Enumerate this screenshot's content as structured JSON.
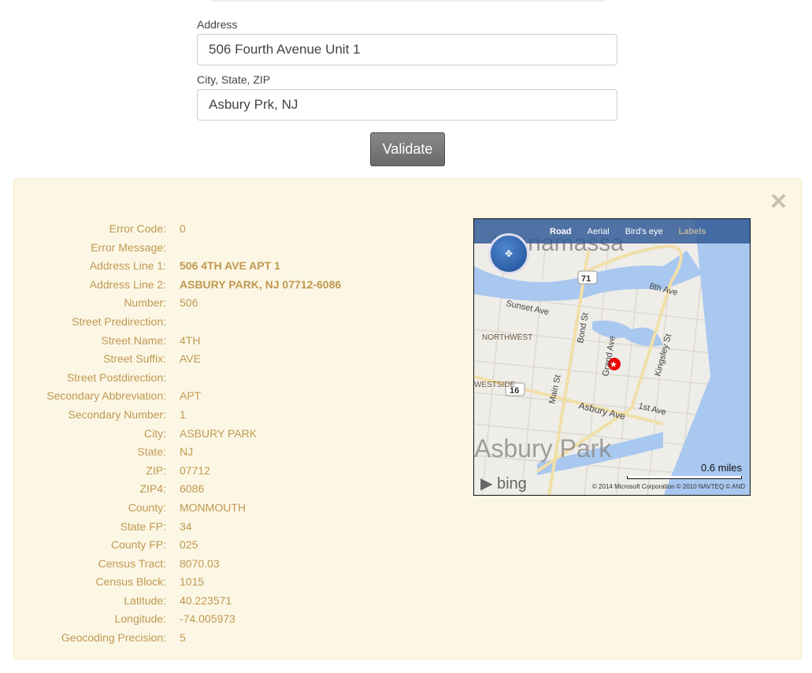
{
  "form": {
    "address_label": "Address",
    "address_value": "506 Fourth Avenue Unit 1",
    "city_label": "City, State, ZIP",
    "city_value": "Asbury Prk, NJ",
    "validate_label": "Validate"
  },
  "result": {
    "close_icon": "×",
    "rows": [
      {
        "label": "Error Code:",
        "value": "0"
      },
      {
        "label": "Error Message:",
        "value": ""
      },
      {
        "label": "Address Line 1:",
        "value": "506 4TH AVE APT 1",
        "bold": true
      },
      {
        "label": "Address Line 2:",
        "value": "ASBURY PARK, NJ 07712-6086",
        "bold": true
      },
      {
        "label": "Number:",
        "value": "506"
      },
      {
        "label": "Street Predirection:",
        "value": ""
      },
      {
        "label": "Street Name:",
        "value": "4TH"
      },
      {
        "label": "Street Suffix:",
        "value": "AVE"
      },
      {
        "label": "Street Postdirection:",
        "value": ""
      },
      {
        "label": "Secondary Abbreviation:",
        "value": "APT"
      },
      {
        "label": "Secondary Number:",
        "value": "1"
      },
      {
        "label": "City:",
        "value": "ASBURY PARK"
      },
      {
        "label": "State:",
        "value": "NJ"
      },
      {
        "label": "ZIP:",
        "value": "07712"
      },
      {
        "label": "ZIP4:",
        "value": "6086"
      },
      {
        "label": "County:",
        "value": "MONMOUTH"
      },
      {
        "label": "State FP:",
        "value": "34"
      },
      {
        "label": "County FP:",
        "value": "025"
      },
      {
        "label": "Census Tract:",
        "value": "8070.03"
      },
      {
        "label": "Census Block:",
        "value": "1015"
      },
      {
        "label": "Latitude:",
        "value": "40.223571"
      },
      {
        "label": "Longitude:",
        "value": "-74.005973"
      },
      {
        "label": "Geocoding Precision:",
        "value": "5"
      }
    ]
  },
  "map": {
    "modes": [
      "Road",
      "Aerial",
      "Bird's eye",
      "Labels"
    ],
    "labels": {
      "town": "Asbury Park",
      "area_top": "Wanamassa",
      "northwest": "NORTHWEST",
      "westside": "WESTSIDE",
      "sunset": "Sunset Ave",
      "bond": "Bond St",
      "grand": "Grand Ave",
      "kingsley": "Kingsley St",
      "main": "Main St",
      "asbury_ave": "Asbury Ave",
      "first": "1st Ave",
      "eighth": "8th Ave",
      "r71": "71",
      "r16": "16"
    },
    "scale": "0.6 miles",
    "logo": "bing",
    "copyright": "© 2014 Microsoft Corporation   © 2010 NAVTEQ   © AND",
    "colors": {
      "water": "#a9c8f0",
      "road": "#f5e6b8",
      "land": "#efede8"
    }
  }
}
